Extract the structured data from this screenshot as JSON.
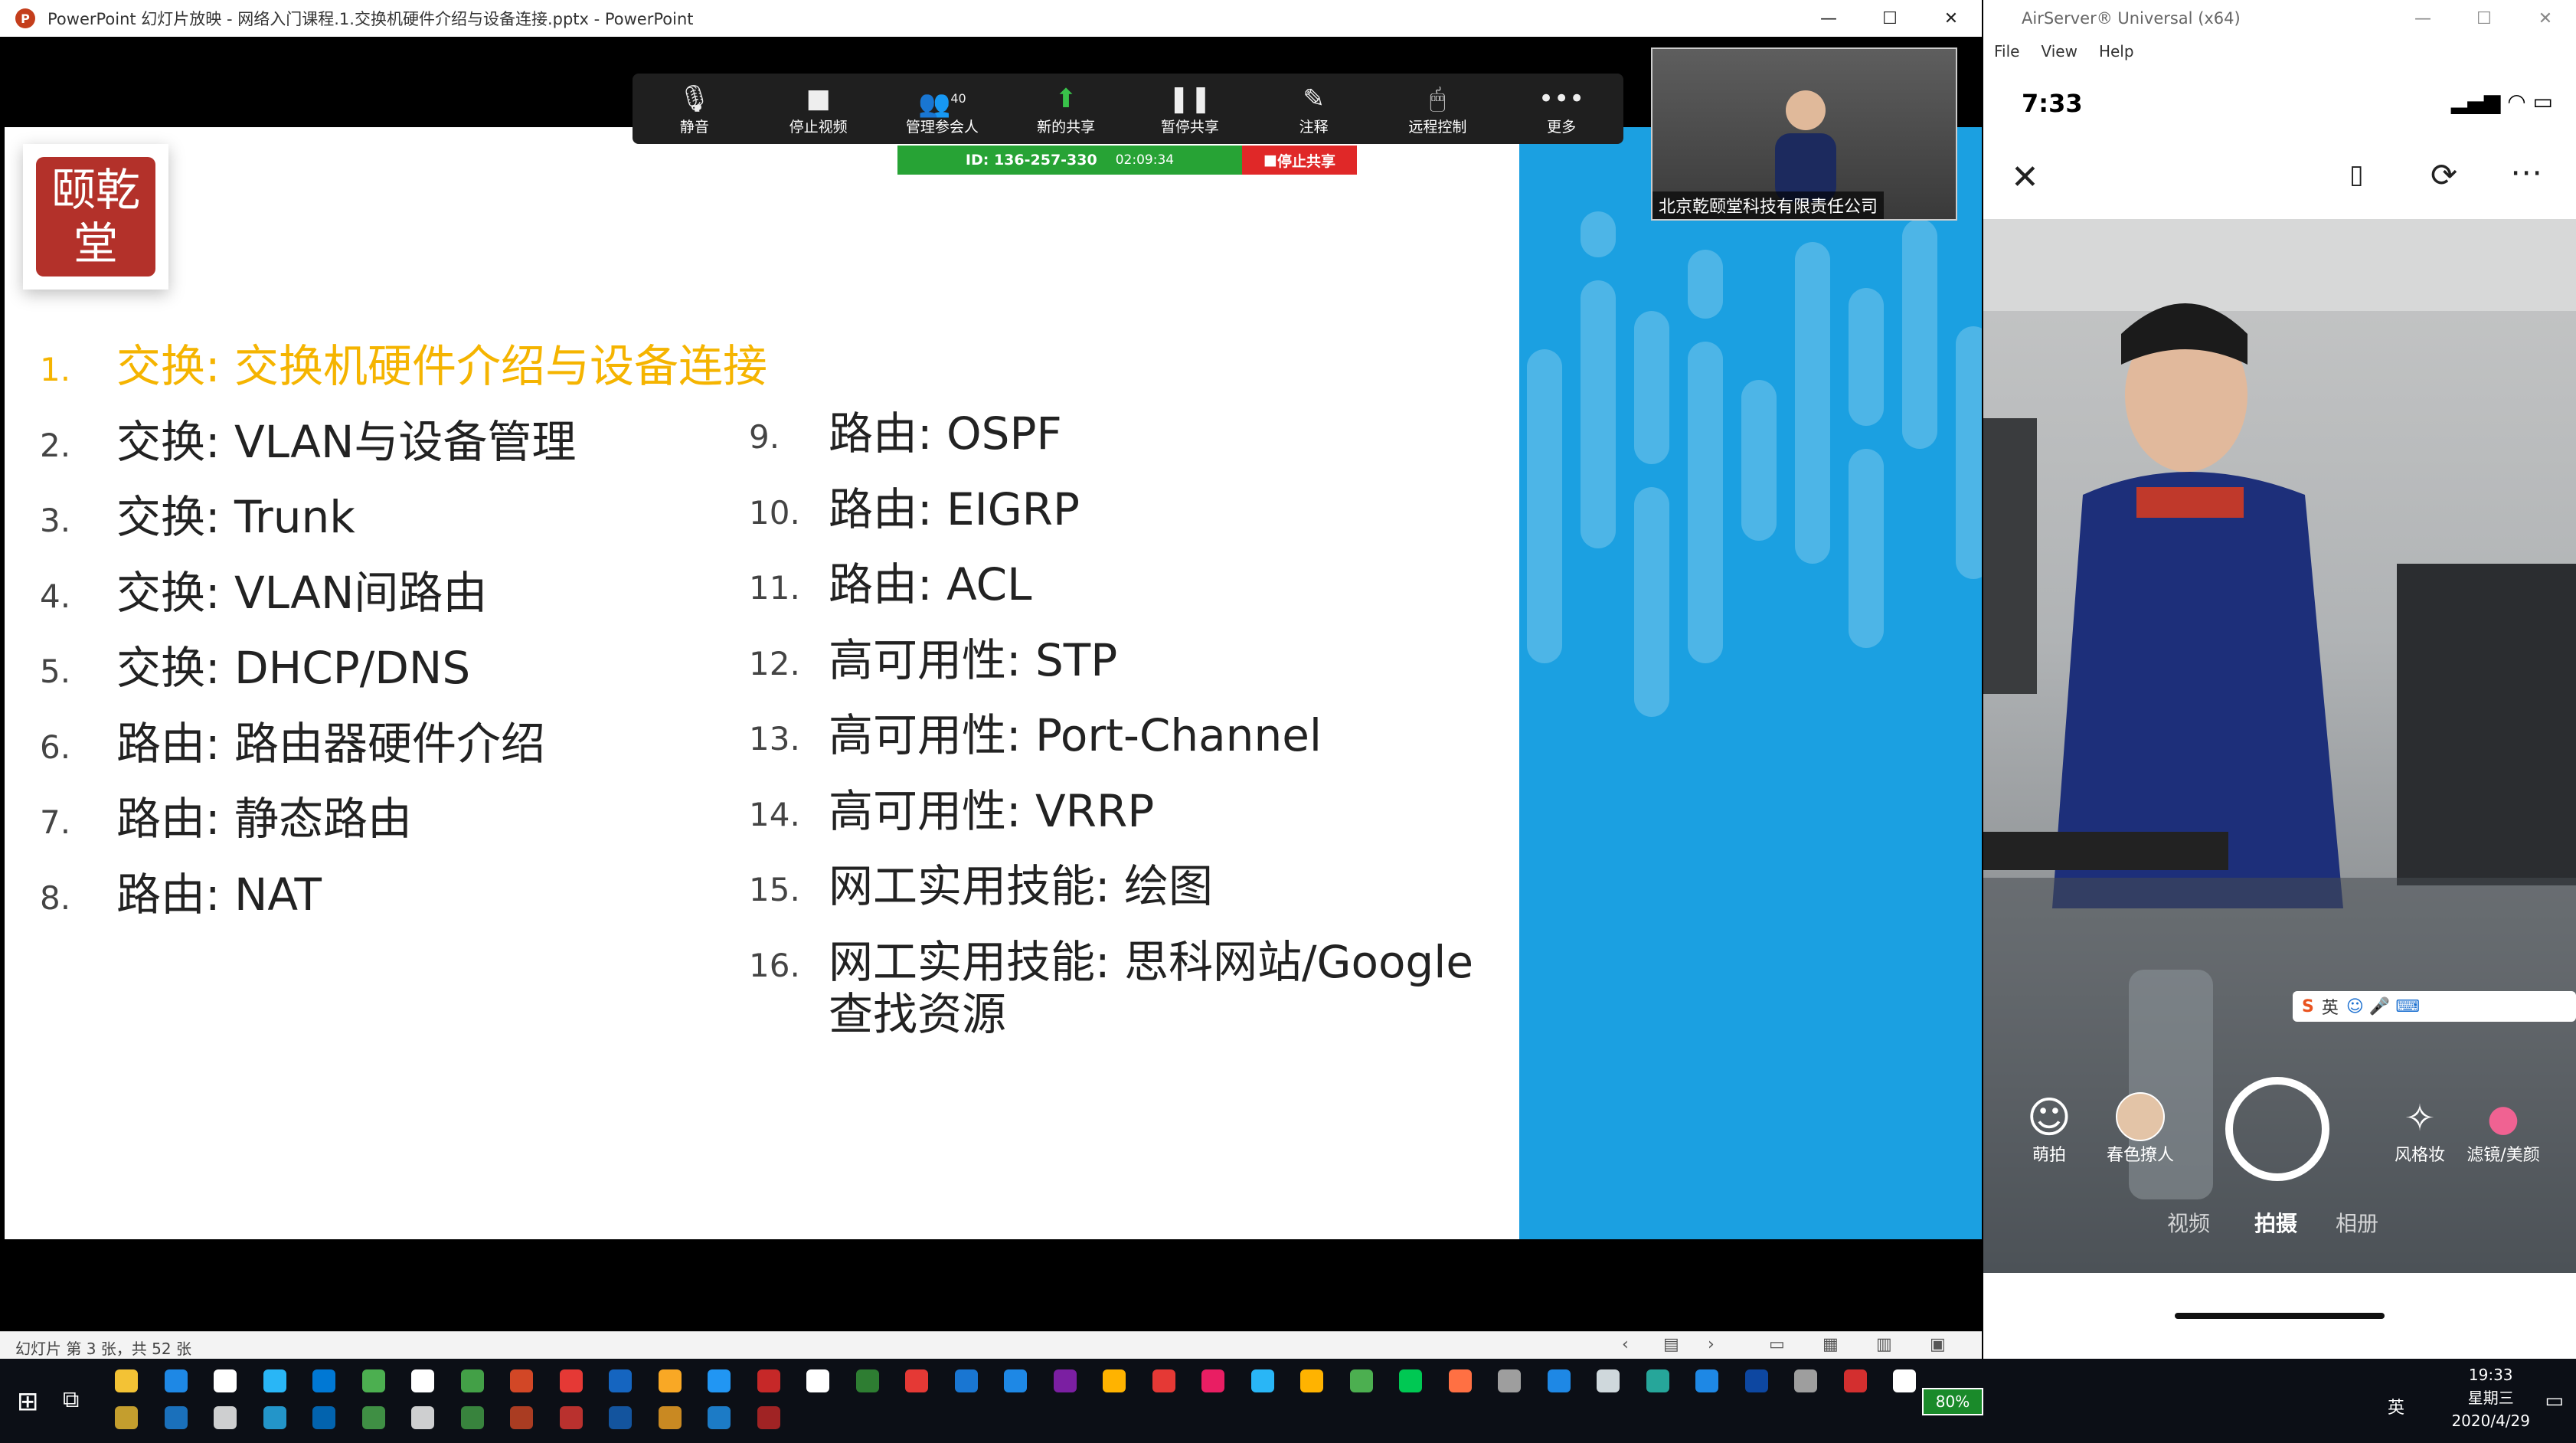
{
  "powerpoint": {
    "title": "PowerPoint 幻灯片放映  -  网络入门课程.1.交换机硬件介绍与设备连接.pptx - PowerPoint",
    "status": "幻灯片 第 3 张，共 52 张"
  },
  "window_controls": {
    "minimize": "—",
    "maximize": "☐",
    "close": "✕"
  },
  "zoom": {
    "toolbar": [
      {
        "label": "静音",
        "icon": "mic-icon"
      },
      {
        "label": "停止视频",
        "icon": "video-camera-icon"
      },
      {
        "label": "管理参会人",
        "icon": "participants-icon",
        "badge": "40"
      },
      {
        "label": "新的共享",
        "icon": "share-screen-icon"
      },
      {
        "label": "暂停共享",
        "icon": "pause-icon"
      },
      {
        "label": "注释",
        "icon": "pen-icon"
      },
      {
        "label": "远程控制",
        "icon": "mouse-icon"
      },
      {
        "label": "更多",
        "icon": "more-icon"
      }
    ],
    "meeting_id": "ID: 136-257-330",
    "timer": "02:09:34",
    "stop_share": "停止共享",
    "video_label": "北京乾颐堂科技有限责任公司"
  },
  "slide": {
    "logo_text": "颐乾堂",
    "items_left": [
      {
        "num": "1.",
        "text": "交换: 交换机硬件介绍与设备连接",
        "active": true
      },
      {
        "num": "2.",
        "text": "交换: VLAN与设备管理"
      },
      {
        "num": "3.",
        "text": "交换: Trunk"
      },
      {
        "num": "4.",
        "text": "交换: VLAN间路由"
      },
      {
        "num": "5.",
        "text": "交换: DHCP/DNS"
      },
      {
        "num": "6.",
        "text": "路由: 路由器硬件介绍"
      },
      {
        "num": "7.",
        "text": "路由: 静态路由"
      },
      {
        "num": "8.",
        "text": "路由: NAT"
      }
    ],
    "items_right": [
      {
        "num": "9.",
        "text": "路由: OSPF"
      },
      {
        "num": "10.",
        "text": "路由: EIGRP"
      },
      {
        "num": "11.",
        "text": "路由: ACL"
      },
      {
        "num": "12.",
        "text": "高可用性: STP"
      },
      {
        "num": "13.",
        "text": "高可用性: Port-Channel"
      },
      {
        "num": "14.",
        "text": "高可用性: VRRP"
      },
      {
        "num": "15.",
        "text": "网工实用技能: 绘图"
      },
      {
        "num": "16.",
        "text": "网工实用技能: 思科网站/Google",
        "text2": "查找资源"
      }
    ],
    "accent_color": "#f5b400",
    "blue_color": "#1ba0e1"
  },
  "airserver": {
    "title": "AirServer® Universal (x64)",
    "menu": [
      "File",
      "View",
      "Help"
    ]
  },
  "phone": {
    "time": "7:33",
    "camera_controls": {
      "cute": "萌拍",
      "filter_person": "春色撩人",
      "style_makeup": "风格妆",
      "filter_beauty": "滤镜/美颜"
    },
    "tabs": [
      "视频",
      "拍摄",
      "相册"
    ],
    "ime_bar": "英"
  },
  "taskbar": {
    "battery": "80%",
    "ime": "英",
    "time": "19:33",
    "weekday": "星期三",
    "date": "2020/4/29"
  }
}
